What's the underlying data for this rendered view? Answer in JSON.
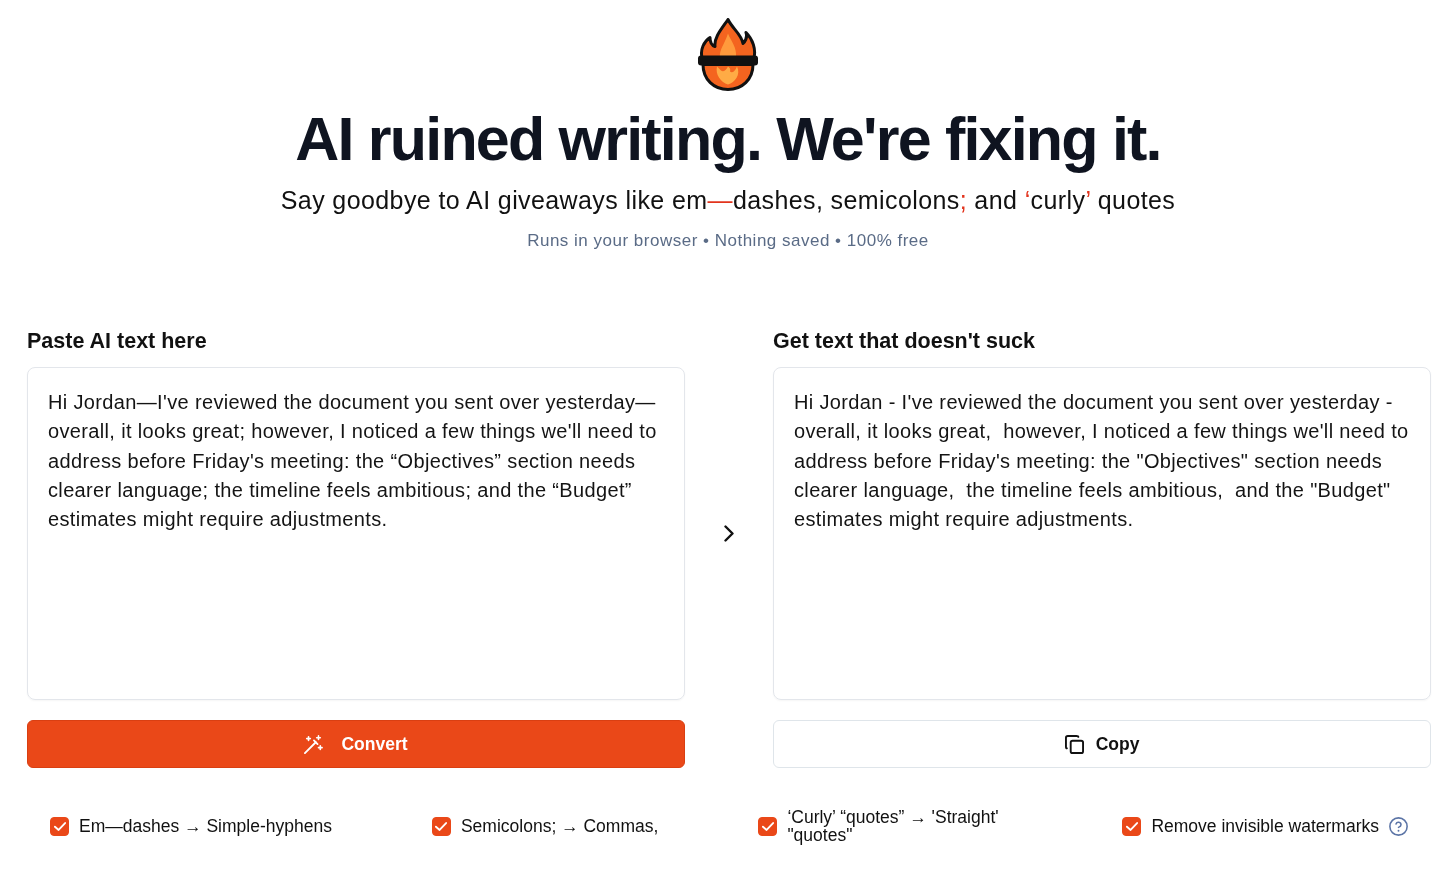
{
  "header": {
    "title": "AI ruined writing. We're fixing it.",
    "subtitle": [
      {
        "text": "Say goodbye to AI giveaways like em",
        "highlight": false
      },
      {
        "text": "—",
        "highlight": true
      },
      {
        "text": "dashes, semicolons",
        "highlight": false
      },
      {
        "text": ";",
        "highlight": true
      },
      {
        "text": " and ",
        "highlight": false
      },
      {
        "text": "‘",
        "highlight": true
      },
      {
        "text": "curly",
        "highlight": false
      },
      {
        "text": "’",
        "highlight": true
      },
      {
        "text": " quotes",
        "highlight": false
      }
    ],
    "tagline": "Runs in your browser • Nothing saved • 100% free"
  },
  "input_panel": {
    "label": "Paste AI text here",
    "value": "Hi Jordan—I've reviewed the document you sent over yesterday—overall, it looks great; however, I noticed a few things we'll need to address before Friday's meeting: the “Objectives” section needs clearer language; the timeline feels ambitious; and the “Budget” estimates might require adjustments.",
    "button": "Convert"
  },
  "output_panel": {
    "label": "Get text that doesn't suck",
    "value": "Hi Jordan - I've reviewed the document you sent over yesterday - overall, it looks great,  however, I noticed a few things we'll need to address before Friday's meeting: the \"Objectives\" section needs clearer language,  the timeline feels ambitious,  and the \"Budget\" estimates might require adjustments.",
    "button": "Copy"
  },
  "options": [
    {
      "label": "Em—dashes → Simple-hyphens",
      "checked": true,
      "help": false
    },
    {
      "label": "Semicolons; → Commas,",
      "checked": true,
      "help": false
    },
    {
      "label": "‘Curly’ “quotes” → 'Straight' \"quotes\"",
      "checked": true,
      "help": false
    },
    {
      "label": "Remove invisible watermarks",
      "checked": true,
      "help": true
    }
  ]
}
